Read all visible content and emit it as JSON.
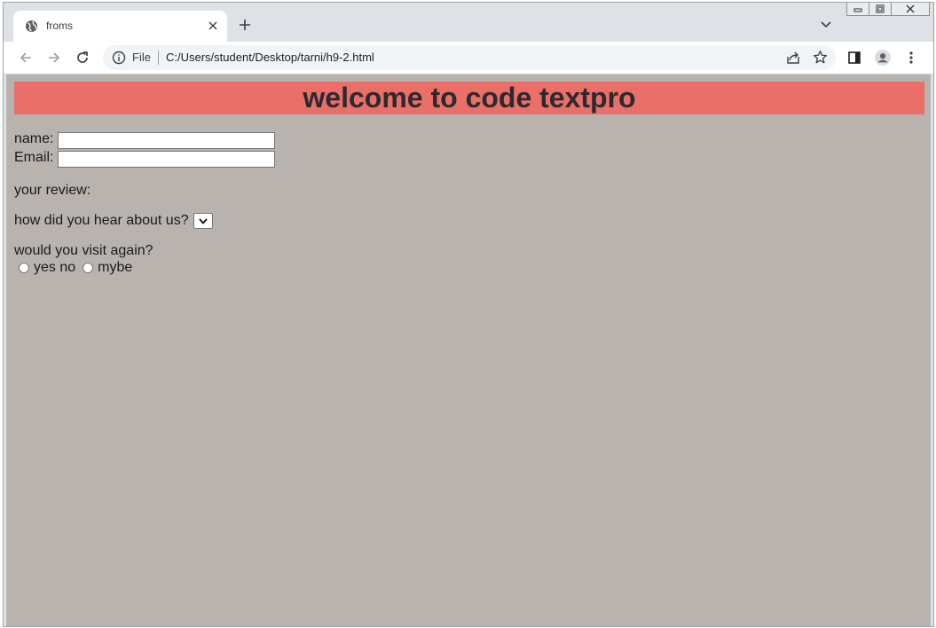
{
  "browser": {
    "tab": {
      "title": "froms"
    },
    "address": {
      "scheme_label": "File",
      "url": "C:/Users/student/Desktop/tarni/h9-2.html"
    }
  },
  "page": {
    "heading": "welcome to code textpro",
    "background_color": "#b8b3af",
    "banner_color": "#e96f68",
    "form": {
      "name_label": "name:",
      "email_label": "Email:",
      "review_label": "your review:",
      "hear_label": "how did you hear about us?",
      "visit_label": "would you visit again?",
      "radio_yes_no_label": "yes no",
      "radio_maybe_label": "mybe"
    }
  }
}
